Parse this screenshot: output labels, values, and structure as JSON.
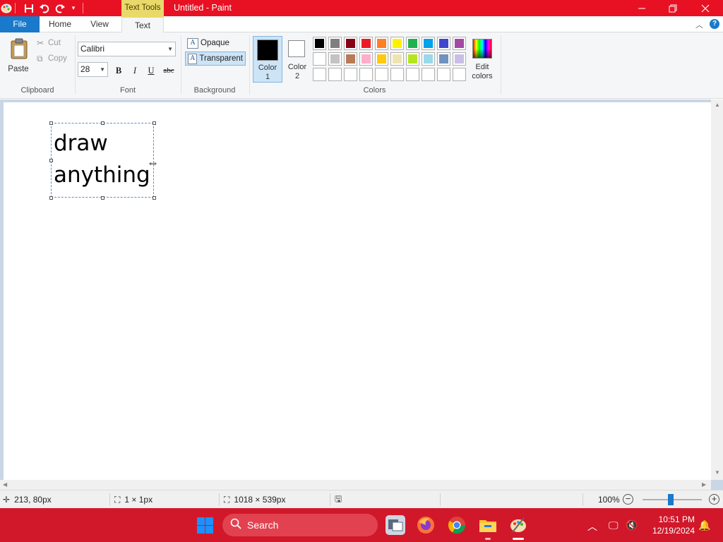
{
  "window": {
    "title": "Untitled - Paint",
    "context_tab_label": "Text Tools"
  },
  "ribbon_tabs": {
    "file": "File",
    "home": "Home",
    "view": "View",
    "text": "Text"
  },
  "clipboard": {
    "paste": "Paste",
    "cut": "Cut",
    "copy": "Copy",
    "group_label": "Clipboard"
  },
  "font": {
    "family": "Calibri",
    "size": "28",
    "bold": "B",
    "italic": "I",
    "underline": "U",
    "strikethrough": "abc",
    "group_label": "Font"
  },
  "background": {
    "opaque": "Opaque",
    "transparent": "Transparent",
    "selected": "Transparent",
    "group_label": "Background"
  },
  "colors": {
    "color1_line1": "Color",
    "color1_line2": "1",
    "color1_value": "#000000",
    "color2_line1": "Color",
    "color2_line2": "2",
    "color2_value": "#ffffff",
    "edit_line1": "Edit",
    "edit_line2": "colors",
    "group_label": "Colors",
    "palette_row1": [
      "#000000",
      "#7f7f7f",
      "#880015",
      "#ed1c24",
      "#ff7f27",
      "#fff200",
      "#22b14c",
      "#00a2e8",
      "#3f48cc",
      "#a349a4"
    ],
    "palette_row2": [
      "#ffffff",
      "#c3c3c3",
      "#b97a57",
      "#ffaec9",
      "#ffc90e",
      "#efe4b0",
      "#b5e61d",
      "#99d9ea",
      "#7092be",
      "#c8bfe7"
    ]
  },
  "canvas": {
    "text_line1": "draw",
    "text_line2": "anything"
  },
  "statusbar": {
    "cursor_position": "213, 80px",
    "selection_size": "1 × 1px",
    "image_size": "1018 × 539px",
    "zoom": "100%"
  },
  "taskbar": {
    "search_placeholder": "Search",
    "time": "10:51 PM",
    "date": "12/19/2024"
  }
}
